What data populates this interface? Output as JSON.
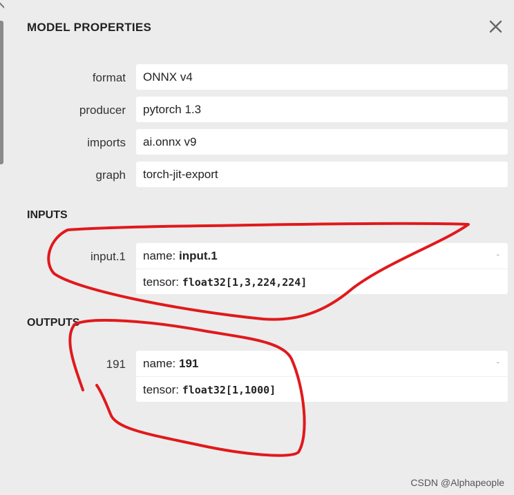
{
  "dialog": {
    "title": "MODEL PROPERTIES",
    "close_icon": "close-icon"
  },
  "properties": [
    {
      "label": "format",
      "value": "ONNX v4"
    },
    {
      "label": "producer",
      "value": "pytorch 1.3"
    },
    {
      "label": "imports",
      "value": "ai.onnx v9"
    },
    {
      "label": "graph",
      "value": "torch-jit-export"
    }
  ],
  "inputs": {
    "header": "INPUTS",
    "items": [
      {
        "label": "input.1",
        "name_prefix": "name: ",
        "name": "input.1",
        "tensor_prefix": "tensor: ",
        "tensor": "float32[1,3,224,224]",
        "expander": "-"
      }
    ]
  },
  "outputs": {
    "header": "OUTPUTS",
    "items": [
      {
        "label": "191",
        "name_prefix": "name: ",
        "name": "191",
        "tensor_prefix": "tensor: ",
        "tensor": "float32[1,1000]",
        "expander": "-"
      }
    ]
  },
  "watermark": "CSDN @Alphapeople",
  "colors": {
    "panel_bg": "#ececec",
    "field_bg": "#ffffff",
    "annotation": "#e0191c"
  }
}
